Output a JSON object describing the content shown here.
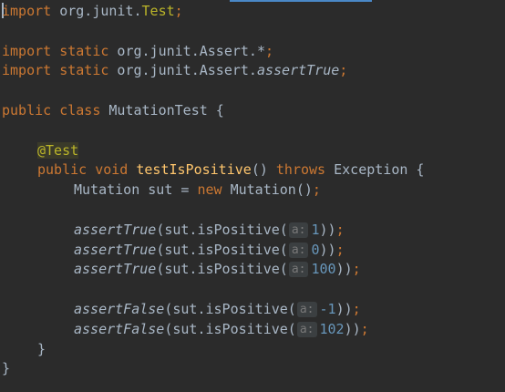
{
  "lines": {
    "l1": {
      "kw": "import",
      "pkg": " org.junit.",
      "cls": "Test",
      "semi": ";"
    },
    "l3": {
      "kw1": "import",
      "kw2": " static",
      "pkg": " org.junit.Assert.*",
      "semi": ";"
    },
    "l4": {
      "kw1": "import",
      "kw2": " static",
      "pkg": " org.junit.Assert.",
      "method": "assertTrue",
      "semi": ";"
    },
    "l6": {
      "kw1": "public",
      "kw2": " class",
      "name": " MutationTest {"
    },
    "l8": {
      "annotation": "@Test"
    },
    "l9": {
      "kw1": "public",
      "kw2": " void",
      "method": " testIsPositive",
      "params": "() ",
      "throws": "throws",
      "exc": " Exception {"
    },
    "l10": {
      "cls": "Mutation sut = ",
      "kw": "new",
      "rest": " Mutation()",
      "semi": ";"
    },
    "l12": {
      "method": "assertTrue",
      "call": "(sut.isPositive(",
      "hint": "a:",
      "value": "1",
      "close": "))",
      "semi": ";"
    },
    "l13": {
      "method": "assertTrue",
      "call": "(sut.isPositive(",
      "hint": "a:",
      "value": "0",
      "close": "))",
      "semi": ";"
    },
    "l14": {
      "method": "assertTrue",
      "call": "(sut.isPositive(",
      "hint": "a:",
      "value": "100",
      "close": "))",
      "semi": ";"
    },
    "l16": {
      "method": "assertFalse",
      "call": "(sut.isPositive(",
      "hint": "a:",
      "value": "-1",
      "close": "))",
      "semi": ";"
    },
    "l17": {
      "method": "assertFalse",
      "call": "(sut.isPositive(",
      "hint": "a:",
      "value": "102",
      "close": "))",
      "semi": ";"
    },
    "l18": {
      "brace": "}"
    },
    "l19": {
      "brace": "}"
    }
  },
  "colors": {
    "background": "#2b2b2b",
    "keyword": "#cc7832",
    "method_declaration": "#ffc66d",
    "annotation": "#bbb529",
    "number": "#6897bb",
    "text": "#a9b7c6"
  }
}
